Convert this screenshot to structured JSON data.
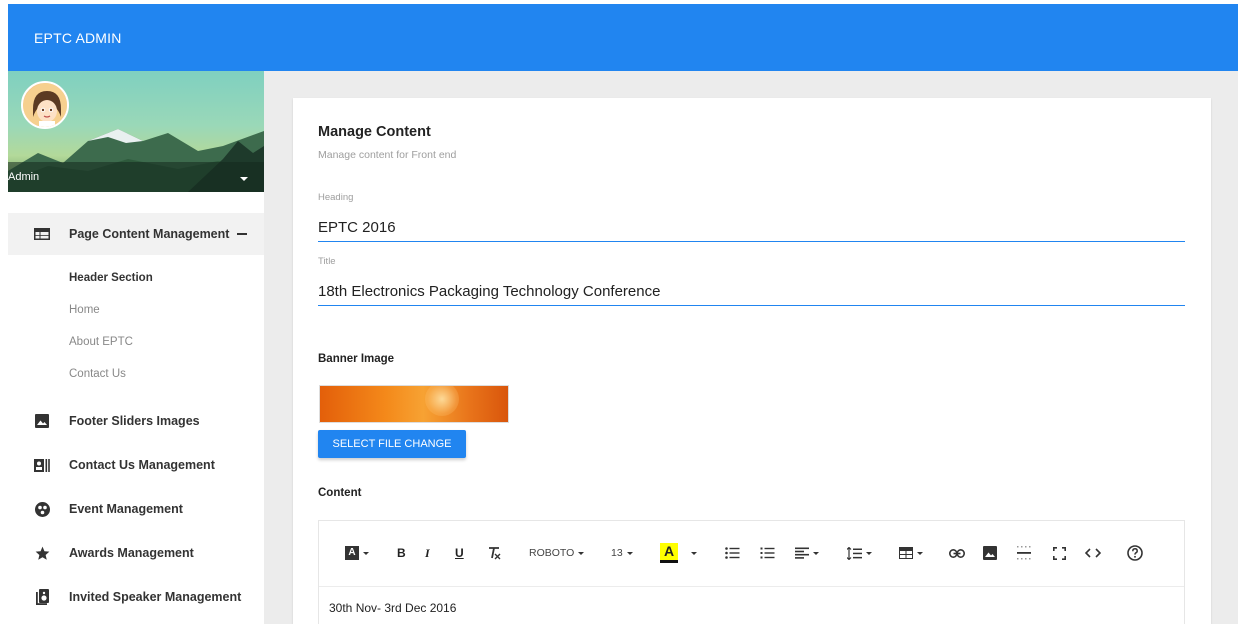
{
  "app": {
    "title": "EPTC ADMIN"
  },
  "profile": {
    "name": "Admin"
  },
  "sidebar": {
    "items": [
      {
        "label": "Page Content Management",
        "icon": "table-icon",
        "expanded": true
      },
      {
        "label": "Footer Sliders Images",
        "icon": "image-icon"
      },
      {
        "label": "Contact Us Management",
        "icon": "contact-card-icon"
      },
      {
        "label": "Event Management",
        "icon": "globe-icon"
      },
      {
        "label": "Awards Management",
        "icon": "star-icon"
      },
      {
        "label": "Invited Speaker Management",
        "icon": "speaker-icon"
      }
    ],
    "subitems": [
      "Header Section",
      "Home",
      "About EPTC",
      "Contact Us"
    ]
  },
  "page": {
    "title": "Manage Content",
    "subtitle": "Manage content for Front end",
    "heading_label": "Heading",
    "heading_value": "EPTC 2016",
    "title_label": "Title",
    "title_value": "18th Electronics Packaging Technology Conference",
    "banner_label": "Banner Image",
    "file_button": "SELECT FILE CHANGE",
    "content_label": "Content"
  },
  "editor": {
    "font_name": "ROBOTO",
    "font_size": "13",
    "content_text": "30th Nov- 3rd Dec 2016"
  },
  "colors": {
    "primary": "#2185f0",
    "highlight": "#ffff00"
  }
}
